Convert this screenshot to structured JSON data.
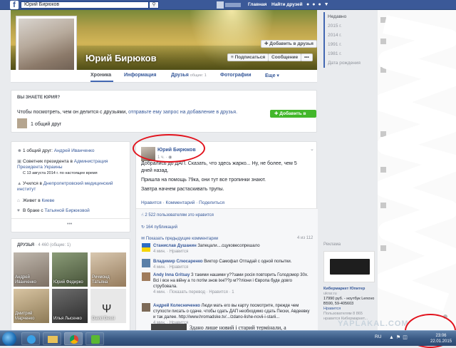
{
  "topbar": {
    "search_value": "Юрий Бирюков",
    "nav_home": "Главная",
    "nav_find_friends": "Найти друзей"
  },
  "profile": {
    "name": "Юрий Бирюков",
    "add_friend": "Добавить в друзья",
    "follow": "Подписаться",
    "message": "Сообщение",
    "more_dots": "•••"
  },
  "tabs": {
    "timeline": "Хроника",
    "info": "Информация",
    "friends": "Друзья",
    "friends_count": "общие: 1",
    "photos": "Фотографии",
    "more": "Еще"
  },
  "know_card": {
    "title": "ВЫ ЗНАЕТЕ ЮРИЯ?",
    "text": "Чтобы посмотреть, чем он делится с друзьями,",
    "link": "отправьте ему запрос на добавление в друзья.",
    "button": "Добавить в друзья",
    "mutual": "1 общий друг"
  },
  "about": {
    "mutual_prefix": "1 общий друг:",
    "mutual_name": "Андрей Иванченко",
    "job_prefix": "Советник президента в",
    "job_org": "Администрация Президента Украины",
    "job_date": "С 13 августа 2014 г. по настоящее время",
    "study_prefix": "Учился в",
    "study_org": "Днепропетровский медицинский институт",
    "lives_prefix": "Живет в",
    "lives_city": "Киеве",
    "married_prefix": "В браке с",
    "married_name": "Татьяной Бирюковой",
    "more": "•••"
  },
  "friends_card": {
    "title": "ДРУЗЬЯ",
    "count": "· 4 460 (общие: 1)",
    "tiles": [
      "Андрей Иванченко",
      "Юрий Федирко",
      "Ричмонд Татьяна",
      "Дмитрий Марченко",
      "Илья Лысенко",
      "David Dessi"
    ]
  },
  "post": {
    "author": "Юрий Бирюков",
    "time": "1 ч. · ",
    "line1": "Добрались до ДАП. Сказать, что здесь жарко... Ну, не более, чем 5 дней назад.",
    "line2": "Пришла на помощь 79ка, они тут все тропинки знают.",
    "line3": "Завтра начнем растаскивать трупы.",
    "actions": "Нравится · Комментарий · Поделиться",
    "likes": "2 522 пользователям это нравится",
    "shares": "164 публикаций",
    "prev_comments": "Показать предыдущие комментарии",
    "comments_count": "4 из 112"
  },
  "comments": [
    {
      "name": "Станислав Душанин",
      "text": "Запецали....сцуковесопрешало",
      "meta": "4 мин. · Нравится"
    },
    {
      "name": "Владимир Слюсаренко",
      "text": "Виктор Самофал Отпадай с одной попытки.",
      "meta": "4 мин. · Нравится"
    },
    {
      "name": "Andy Inna Gritsay",
      "text": "З такими нашими у??зами росія повторить Голодомор 30х. Всі і все на війну а то потім знов іхні??р м??ліони і Європа буде довго струбовала.",
      "meta": "4 мин. · Показать перевод · Нравится · 1"
    },
    {
      "name": "Андрей Колесниченко",
      "text": "Люди мать его вы карту посмотрите, прежде чем ступости писать о сдаче. чтобы сдать ДАП необходимо сдать Пески, Авдеевку и так далее. http://www.hromadske.tv/.../zdano-lishe-novii-i-starii...",
      "meta": "4 мин. · Нравится"
    }
  ],
  "preview_text": "Здано лише новий і старий термінали, а",
  "right": {
    "years": [
      "Недавно",
      "2015 г.",
      "2014 г.",
      "1991 г.",
      "1981 г.",
      "Дата рождения"
    ],
    "ads_title": "Реклама",
    "ad_name": "Кибермаркет Юпитер",
    "ad_domain": "ukrar.ru",
    "ad_text": "17990 руб. - ноутбук Lenovo B590, 59-405603",
    "ad_like": "Нравится",
    "ad_more": "Пользователям 8 865 нравится Кибермаркет..."
  },
  "taskbar": {
    "lang": "RU",
    "time": "23:06",
    "date": "22.01.2015"
  },
  "watermark": "YAPLAKAL.COM"
}
